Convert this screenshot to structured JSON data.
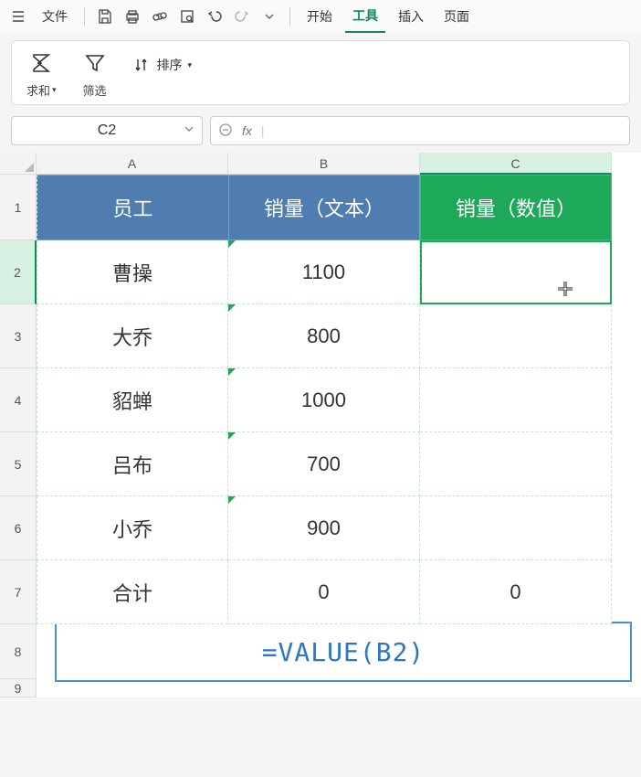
{
  "menubar": {
    "file_label": "文件",
    "tabs": {
      "start": "开始",
      "tools": "工具",
      "insert": "插入",
      "page": "页面"
    }
  },
  "ribbon": {
    "sum_label": "求和",
    "filter_label": "筛选",
    "sort_label": "排序"
  },
  "namebox": {
    "value": "C2"
  },
  "formula_bar": {
    "fx_label": "fx",
    "value": ""
  },
  "columns": [
    "A",
    "B",
    "C"
  ],
  "row_numbers": [
    "1",
    "2",
    "3",
    "4",
    "5",
    "6",
    "7",
    "8",
    "9"
  ],
  "table": {
    "headers": {
      "a": "员工",
      "b": "销量（文本）",
      "c": "销量（数值）"
    },
    "rows": [
      {
        "a": "曹操",
        "b": "1100",
        "c": ""
      },
      {
        "a": "大乔",
        "b": "800",
        "c": ""
      },
      {
        "a": "貂蝉",
        "b": "1000",
        "c": ""
      },
      {
        "a": "吕布",
        "b": "700",
        "c": ""
      },
      {
        "a": "小乔",
        "b": "900",
        "c": ""
      },
      {
        "a": "合计",
        "b": "0",
        "c": "0"
      }
    ]
  },
  "formula_display": "=VALUE(B2)"
}
